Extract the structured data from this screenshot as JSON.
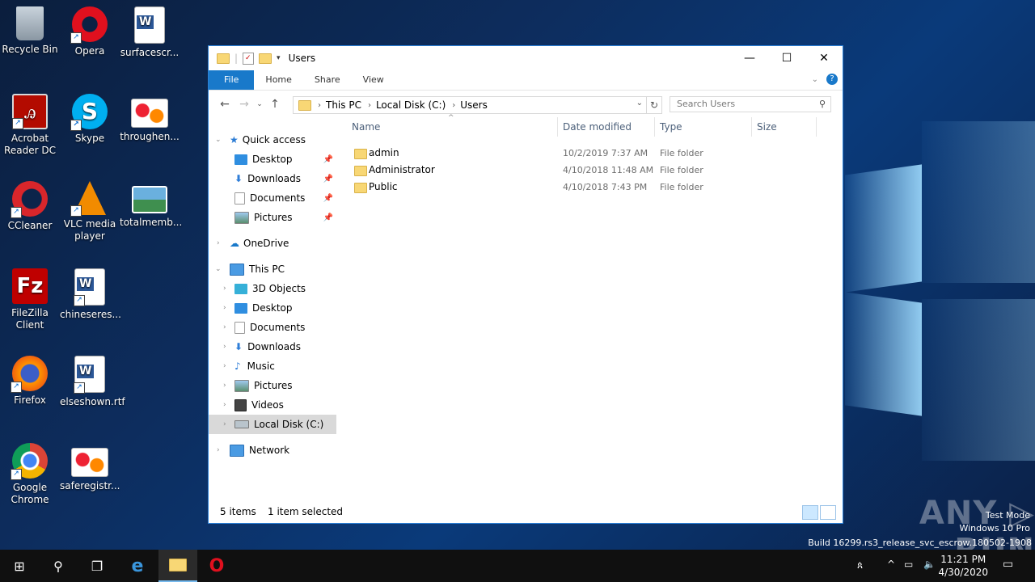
{
  "desktop": {
    "icons": [
      {
        "label": "Recycle Bin"
      },
      {
        "label": "Opera"
      },
      {
        "label": "surfacescr..."
      },
      {
        "label": "Acrobat Reader DC"
      },
      {
        "label": "Skype"
      },
      {
        "label": "throughen..."
      },
      {
        "label": "CCleaner"
      },
      {
        "label": "VLC media player"
      },
      {
        "label": "totalmemb..."
      },
      {
        "label": "FileZilla Client"
      },
      {
        "label": "chineseres..."
      },
      {
        "label": "Firefox"
      },
      {
        "label": "elseshown.rtf"
      },
      {
        "label": "Google Chrome"
      },
      {
        "label": "saferegistr..."
      }
    ]
  },
  "window": {
    "title": "Users",
    "controls": {
      "minimize": "—",
      "maximize": "☐",
      "close": "✕"
    },
    "ribbon_tabs": [
      "File",
      "Home",
      "Share",
      "View"
    ],
    "address": {
      "segments": [
        "This PC",
        "Local Disk (C:)",
        "Users"
      ]
    },
    "search_placeholder": "Search Users",
    "nav": {
      "quick_access": "Quick access",
      "quick_items": [
        "Desktop",
        "Downloads",
        "Documents",
        "Pictures"
      ],
      "onedrive": "OneDrive",
      "this_pc": "This PC",
      "pc_items": [
        "3D Objects",
        "Desktop",
        "Documents",
        "Downloads",
        "Music",
        "Pictures",
        "Videos",
        "Local Disk (C:)"
      ],
      "network": "Network"
    },
    "columns": {
      "name": "Name",
      "date": "Date modified",
      "type": "Type",
      "size": "Size"
    },
    "files": [
      {
        "name": "admin",
        "date": "10/2/2019 7:37 AM",
        "type": "File folder"
      },
      {
        "name": "Administrator",
        "date": "4/10/2018 11:48 AM",
        "type": "File folder"
      },
      {
        "name": "Public",
        "date": "4/10/2018 7:43 PM",
        "type": "File folder"
      }
    ],
    "status": {
      "items": "5 items",
      "selected": "1 item selected"
    }
  },
  "watermark": {
    "brand": "ANY ▷ RUN",
    "line1": "Test Mode",
    "line2": "Windows 10 Pro",
    "line3": "Build 16299.rs3_release_svc_escrow.180502-1908"
  },
  "taskbar": {
    "clock_time": "11:21 PM",
    "clock_date": "4/30/2020"
  },
  "colors": {
    "accent": "#1979ca",
    "selection": "#cce8ff",
    "folder": "#f8d775"
  }
}
